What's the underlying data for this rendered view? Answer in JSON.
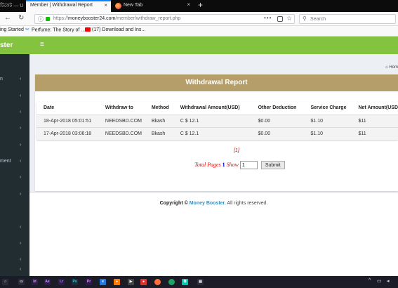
{
  "browser": {
    "prev_tab_fragment": "টিকেট — U",
    "active_tab_title": "Member | Withdrawal Report",
    "second_tab_title": "New Tab",
    "url_prefix": "https://",
    "url_host": "moneybooster24.com",
    "url_path": "/member/withdraw_report.php",
    "search_placeholder": "Search",
    "bookmarks": [
      {
        "label": "ing Started"
      },
      {
        "label": "Perfume: The Story of ..."
      },
      {
        "label": "(17) Download and Ins..."
      }
    ]
  },
  "app": {
    "brand": "ster",
    "sidebar_items": [
      {
        "label": "n",
        "chevron": "‹"
      },
      {
        "label": "",
        "chevron": "‹"
      },
      {
        "label": "",
        "chevron": "‹"
      },
      {
        "label": "",
        "chevron": "‹"
      },
      {
        "label": "",
        "chevron": "‹"
      },
      {
        "label": "ment",
        "chevron": "‹"
      },
      {
        "label": "",
        "chevron": "‹"
      },
      {
        "label": "",
        "chevron": "‹"
      },
      {
        "label": "",
        "chevron": "‹"
      },
      {
        "label": "",
        "chevron": "‹"
      },
      {
        "label": "",
        "chevron": "‹"
      },
      {
        "label": "",
        "chevron": "‹"
      }
    ],
    "breadcrumb": "Hom"
  },
  "report": {
    "title": "Withdrawal Report",
    "columns": [
      "Date",
      "Withdraw to",
      "Method",
      "Withdrawal Amount(USD)",
      "Other Deduction",
      "Service Charge",
      "Net Amount(USD"
    ],
    "rows": [
      [
        "18-Apr-2018 05:01:51",
        "NEEDSBD.COM",
        "Bkash",
        "C $ 12.1",
        "$0.00",
        "$1.10",
        "$11"
      ],
      [
        "17-Apr-2018 03:06:18",
        "NEEDSBD.COM",
        "Bkash",
        "C $ 12.1",
        "$0.00",
        "$1.10",
        "$11"
      ]
    ],
    "page_link": "[1]",
    "total_pages_label": "Total Pages",
    "total_pages_value": "1",
    "show_label": "Show",
    "show_value": "1",
    "submit_label": "Submit"
  },
  "footer": {
    "copyright_label": "Copyright ©",
    "brand": "Money Booster.",
    "rights": "All rights reserved."
  },
  "colors": {
    "header_green": "#84c340",
    "sidebar": "#222d32",
    "report_header": "#b59e6a"
  }
}
